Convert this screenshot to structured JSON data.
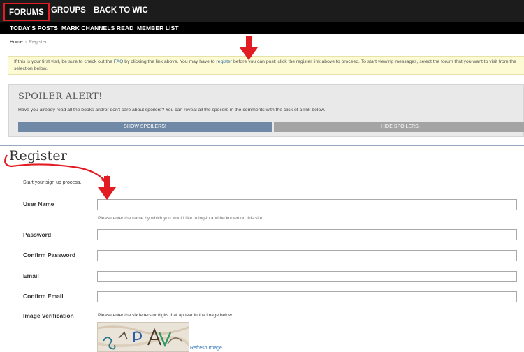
{
  "nav": {
    "tabs": [
      {
        "label": "FORUMS",
        "active": true
      },
      {
        "label": "GROUPS",
        "active": false
      },
      {
        "label": "BACK TO WIC",
        "active": false
      }
    ],
    "subnav": [
      "TODAY'S POSTS",
      "MARK CHANNELS READ",
      "MEMBER LIST"
    ]
  },
  "breadcrumb": {
    "home": "Home",
    "separator": "›",
    "current": "Register"
  },
  "notice": {
    "text_before_faq": "If this is your first visit, be sure to check out the ",
    "faq_link": "FAQ",
    "text_after_faq": " by clicking the link above. You may have to ",
    "register_link": "register",
    "text_after_register": " before you can post: click the register link above to proceed. To start viewing messages, select the forum that you want to visit from the selection below."
  },
  "spoiler": {
    "title": "SPOILER ALERT!",
    "description": "Have you already read all the books and/or don't care about spoilers? You can reveal all the spoilers in the comments with the click of a link below.",
    "show_label": "SHOW SPOILERS!",
    "hide_label": "HIDE SPOILERS."
  },
  "register": {
    "title": "Register",
    "intro": "Start your sign up process.",
    "fields": {
      "username": {
        "label": "User Name",
        "hint": "Please enter the name by which you would like to log-in and be known on this site.",
        "value": ""
      },
      "password": {
        "label": "Password",
        "value": ""
      },
      "confirm_password": {
        "label": "Confirm Password",
        "value": ""
      },
      "email": {
        "label": "Email",
        "value": ""
      },
      "confirm_email": {
        "label": "Confirm Email",
        "value": ""
      }
    },
    "verification": {
      "label": "Image Verification",
      "hint": "Please enter the six letters or digits that appear in the image below.",
      "refresh_label": "Refresh Image"
    }
  },
  "colors": {
    "annotation_red": "#e21c23",
    "nav_bg": "#1c1c1c",
    "show_button": "#6f89a6",
    "hide_button": "#a4a4a4"
  }
}
